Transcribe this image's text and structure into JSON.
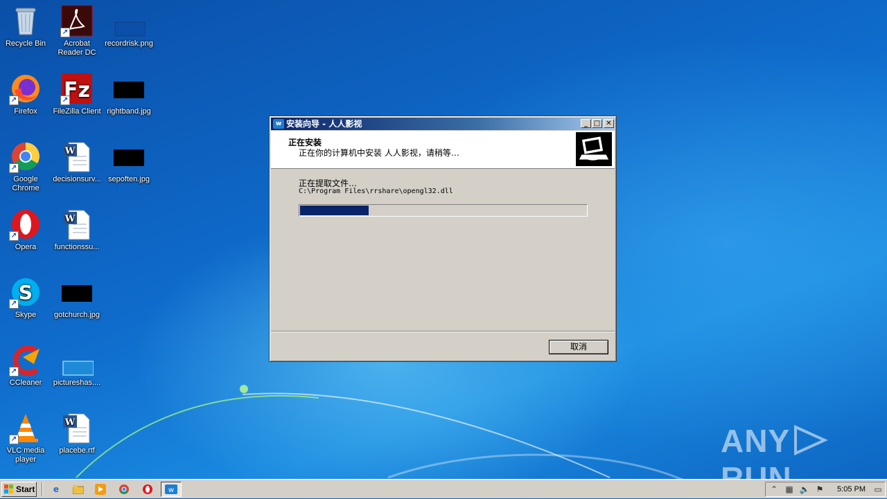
{
  "desktop": {
    "icons": [
      {
        "label": "Recycle Bin"
      },
      {
        "label": "Acrobat Reader DC"
      },
      {
        "label": "recordrisk.png"
      },
      {
        "label": "Firefox"
      },
      {
        "label": "FileZilla Client"
      },
      {
        "label": "rightband.jpg"
      },
      {
        "label": "Google Chrome"
      },
      {
        "label": "decisionsurv..."
      },
      {
        "label": "sepoften.jpg"
      },
      {
        "label": "Opera"
      },
      {
        "label": "functionssu..."
      },
      {
        "label": "Skype"
      },
      {
        "label": "gotchurch.jpg"
      },
      {
        "label": "CCleaner"
      },
      {
        "label": "pictureshas...."
      },
      {
        "label": "VLC media player"
      },
      {
        "label": "placebe.rtf"
      }
    ]
  },
  "installer": {
    "title": "安装向导 - 人人影视",
    "header_title": "正在安装",
    "header_subtitle": "正在你的计算机中安装 人人影视，请稍等…",
    "status": "正在提取文件…",
    "path": "C:\\Program Files\\rrshare\\opengl32.dll",
    "progress": 0.24,
    "cancel_label": "取消"
  },
  "taskbar": {
    "start_label": "Start",
    "clock": "5:05 PM"
  },
  "watermark": {
    "left": "ANY",
    "right": "RUN"
  },
  "colors": {
    "title_gradient_start": "#0a246a",
    "progress_fill": "#0a246a"
  }
}
